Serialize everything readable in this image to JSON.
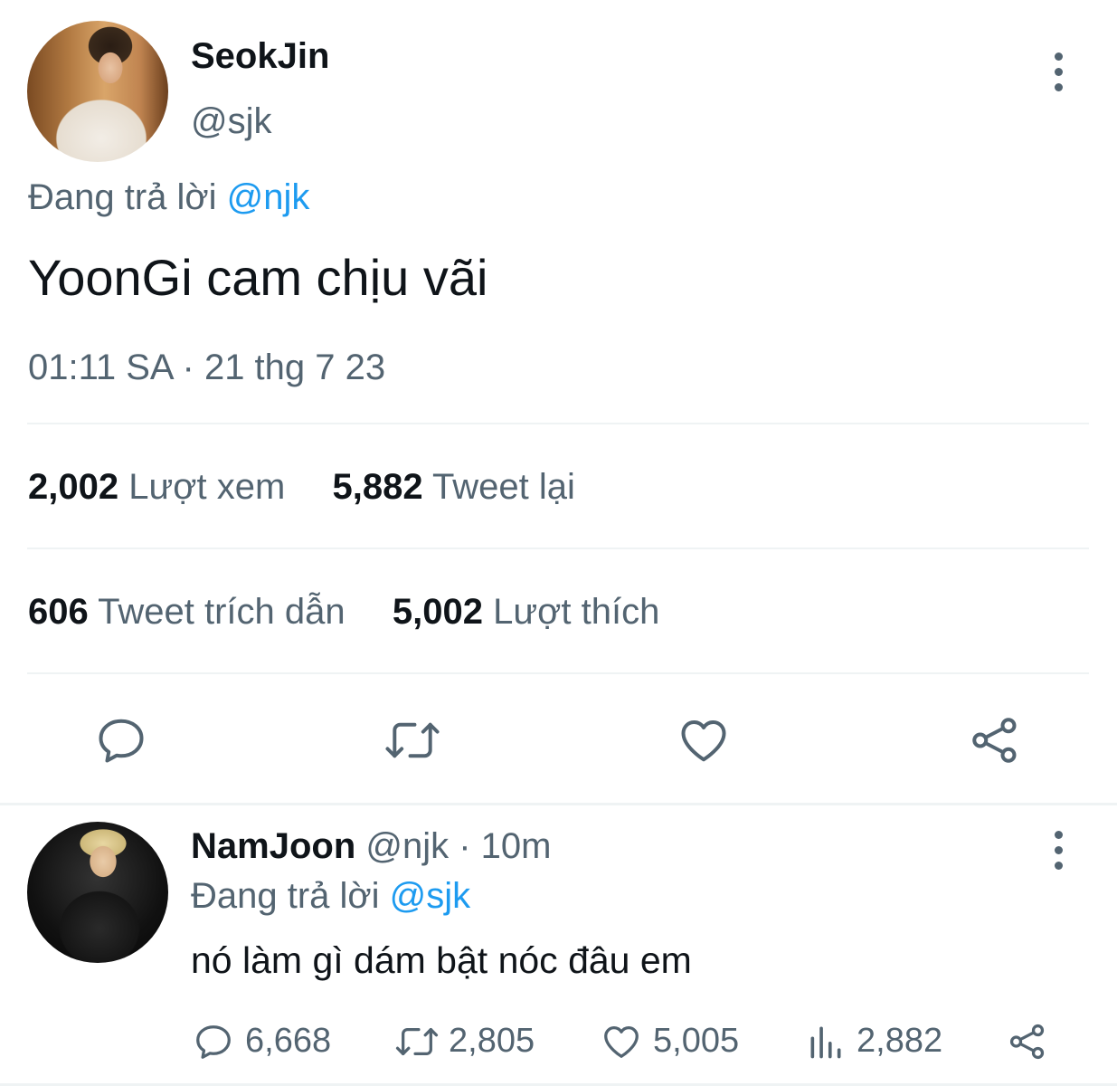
{
  "tweet": {
    "author_name": "SeokJin",
    "author_handle": "@sjk",
    "replying_prefix": "Đang trả lời",
    "replying_to": "@njk",
    "text": "YoonGi cam chịu vãi",
    "timestamp": "01:11 SA · 21 thg 7 23",
    "stats": {
      "views_count": "2,002",
      "views_label": "Lượt xem",
      "retweets_count": "5,882",
      "retweets_label": "Tweet lại",
      "quotes_count": "606",
      "quotes_label": "Tweet trích dẫn",
      "likes_count": "5,002",
      "likes_label": "Lượt thích"
    },
    "actions": [
      "reply-icon",
      "retweet-icon",
      "like-icon",
      "share-icon"
    ]
  },
  "reply": {
    "author_name": "NamJoon",
    "author_handle": "@njk",
    "time": "· 10m",
    "replying_prefix": "Đang trả lời",
    "replying_to": "@sjk",
    "text": "nó làm gì dám bật nóc đâu em",
    "actions": {
      "replies": "6,668",
      "retweets": "2,805",
      "likes": "5,005",
      "views": "2,882"
    }
  },
  "colors": {
    "accent": "#1d9bf0",
    "muted": "#536471",
    "text": "#0f1419",
    "divider": "#eff3f4"
  }
}
